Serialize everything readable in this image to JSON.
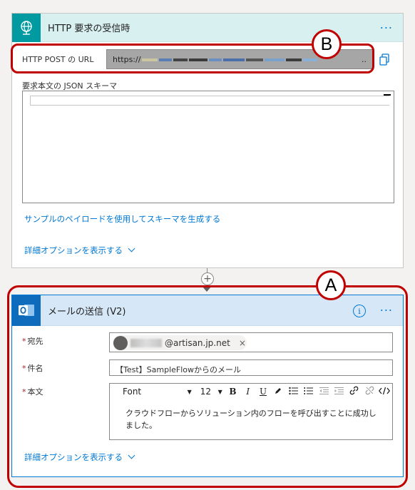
{
  "trigger_card": {
    "title": "HTTP 要求の受信時",
    "url_label": "HTTP POST の URL",
    "url_value": "https://",
    "url_ellipsis": "..",
    "schema_label": "要求本文の JSON スキーマ",
    "generate_link": "サンプルのペイロードを使用してスキーマを生成する",
    "advanced_link": "詳細オプションを表示する"
  },
  "connector": {
    "plus": "+"
  },
  "mail_card": {
    "title": "メールの送信 (V2)",
    "info_label": "i",
    "to_label": "宛先",
    "to_email_suffix": "@artisan.jp.net",
    "to_remove": "×",
    "subject_label": "件名",
    "subject_value": "【Test】SampleFlowからのメール",
    "body_label": "本文",
    "toolbar": {
      "font": "Font",
      "size": "12",
      "bold": "B",
      "italic": "I",
      "underline": "U"
    },
    "body_text": "クラウドフローからソリューション内のフローを呼び出すことに成功しました。",
    "advanced_link": "詳細オプションを表示する",
    "required_mark": "*"
  },
  "callouts": {
    "a": "A",
    "b": "B"
  },
  "colors": {
    "http_accent": "#009aa0",
    "outlook_accent": "#0f6cbd",
    "link": "#0078d4",
    "callout": "#c00000"
  }
}
